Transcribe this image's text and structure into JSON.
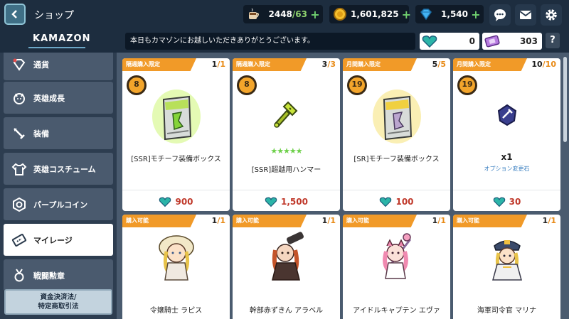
{
  "header": {
    "title": "ショップ",
    "resources": [
      {
        "icon": "coffee-cup-icon",
        "value": "2448",
        "max": "/63"
      },
      {
        "icon": "gold-coin-icon",
        "value": "1,601,825",
        "max": ""
      },
      {
        "icon": "diamond-gem-icon",
        "value": "1,540",
        "max": ""
      }
    ]
  },
  "subbar": {
    "logo": "KAMAZON",
    "notice": "本日もカマゾンにお越しいただきありがとうございます。",
    "mileage": "0",
    "ticket": "303",
    "help": "?"
  },
  "sidebar": {
    "items": [
      {
        "label": "通貨",
        "icon": "gem-currency-icon"
      },
      {
        "label": "英雄成長",
        "icon": "hero-growth-icon"
      },
      {
        "label": "装備",
        "icon": "equipment-icon"
      },
      {
        "label": "英雄コスチューム",
        "icon": "costume-icon"
      },
      {
        "label": "パープルコイン",
        "icon": "purple-coin-icon"
      },
      {
        "label": "マイレージ",
        "icon": "mileage-ticket-icon"
      },
      {
        "label": "戦闘勲章",
        "icon": "medal-icon"
      }
    ],
    "active_index": 5,
    "legal": {
      "line1": "資金決済法/",
      "line2": "特定商取引法"
    }
  },
  "products_row1": [
    {
      "ribbon": "隔週購入限定",
      "count": "1",
      "max": "/1",
      "days": "8",
      "name": "[SSR]モチーフ装備ボックス",
      "price": "900",
      "kind": "box-green"
    },
    {
      "ribbon": "隔週購入限定",
      "count": "3",
      "max": "/3",
      "days": "8",
      "name": "[SSR]超越用ハンマー",
      "stars": "★★★★★",
      "price": "1,500",
      "kind": "hammer"
    },
    {
      "ribbon": "月間購入限定",
      "count": "5",
      "max": "/5",
      "days": "19",
      "name": "[SR]モチーフ装備ボックス",
      "price": "100",
      "kind": "box-gold"
    },
    {
      "ribbon": "月間購入限定",
      "count": "10",
      "max": "/10",
      "days": "19",
      "qty": "x1",
      "sub": "オプション変更石",
      "price": "30",
      "kind": "stone"
    }
  ],
  "products_row2": [
    {
      "ribbon": "購入可能",
      "count": "1",
      "max": "/1",
      "name": "令嬢騎士 ラピス",
      "kind": "hero-lapis"
    },
    {
      "ribbon": "購入可能",
      "count": "1",
      "max": "/1",
      "name": "幹部赤ずきん アラベル",
      "kind": "hero-arabelle"
    },
    {
      "ribbon": "購入可能",
      "count": "1",
      "max": "/1",
      "name": "アイドルキャプテン エヴァ",
      "kind": "hero-eva"
    },
    {
      "ribbon": "購入可能",
      "count": "1",
      "max": "/1",
      "name": "海軍司令官 マリナ",
      "kind": "hero-marina"
    }
  ],
  "colors": {
    "accent": "#f19a28",
    "price": "#c0392b",
    "topbar": "#1d2d3f"
  }
}
